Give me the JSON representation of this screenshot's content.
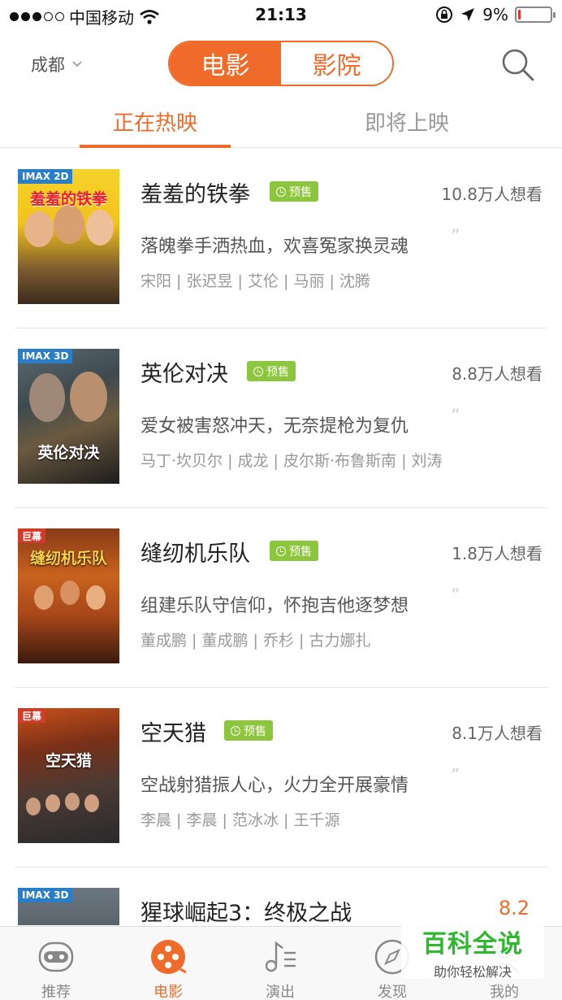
{
  "status_bar": {
    "carrier": "中国移动",
    "time": "21:13",
    "battery_text": "9%",
    "battery_level": 0.09,
    "battery_color": "#e8312c"
  },
  "nav": {
    "city": "成都",
    "segments": [
      "电影",
      "影院"
    ],
    "active_segment": "电影",
    "accent_color": "#f06a2a",
    "search_icon": "search-icon"
  },
  "tabs": {
    "now_showing": "正在热映",
    "coming_soon": "即将上映",
    "active": "正在热映"
  },
  "movies": [
    {
      "title": "羞羞的铁拳",
      "badge": "预售",
      "wish": "10.8万人想看",
      "tagline": "落魄拳手洒热血，欢喜冤家换灵魂",
      "cast": "宋阳 | 张迟昱 | 艾伦 | 马丽 | 沈腾",
      "poster_tag": "IMAX 2D",
      "poster_title": "羞羞的铁拳"
    },
    {
      "title": "英伦对决",
      "badge": "预售",
      "wish": "8.8万人想看",
      "tagline": "爱女被害怒冲天，无奈提枪为复仇",
      "cast": "马丁·坎贝尔 | 成龙 | 皮尔斯·布鲁斯南 | 刘涛",
      "poster_tag": "IMAX 3D",
      "poster_title": "英伦对决"
    },
    {
      "title": "缝纫机乐队",
      "badge": "预售",
      "wish": "1.8万人想看",
      "tagline": "组建乐队守信仰，怀抱吉他逐梦想",
      "cast": "董成鹏 | 董成鹏 | 乔杉 | 古力娜扎",
      "poster_tag": "巨幕",
      "poster_title": "缝纫机乐队"
    },
    {
      "title": "空天猎",
      "badge": "预售",
      "wish": "8.1万人想看",
      "tagline": "空战射猎振人心，火力全开展豪情",
      "cast": "李晨 | 李晨 | 范冰冰 | 王千源",
      "poster_tag": "巨幕",
      "poster_title": "空天猎"
    },
    {
      "title": "猩球崛起3：终极之战",
      "score": "8.2",
      "poster_tag": "IMAX 3D"
    }
  ],
  "tabbar": {
    "items": [
      {
        "label": "推荐",
        "icon": "face-icon"
      },
      {
        "label": "电影",
        "icon": "film-reel-icon"
      },
      {
        "label": "演出",
        "icon": "music-note-icon"
      },
      {
        "label": "发现",
        "icon": "compass-icon"
      },
      {
        "label": "我的",
        "icon": "user-icon"
      }
    ],
    "active": "电影"
  },
  "watermark": {
    "title": "百科全说",
    "subtitle": "助你轻松解决"
  }
}
